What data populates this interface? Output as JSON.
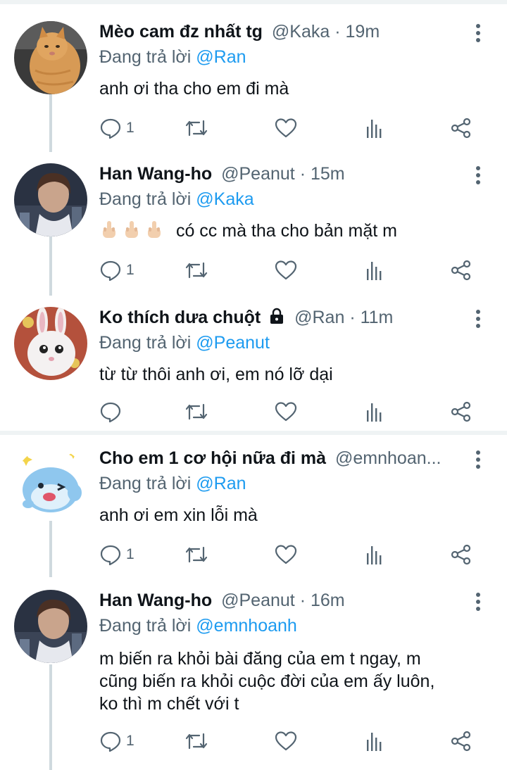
{
  "tweets": [
    {
      "name": "Mèo cam đz nhất tg",
      "handle": "@Kaka",
      "time": "19m",
      "reply_prefix": "Đang trả lời",
      "reply_to": "@Ran",
      "text": "anh ơi tha cho em đi mà",
      "reply_count": "1",
      "avatar": "cat-avatar"
    },
    {
      "name": "Han Wang-ho",
      "handle": "@Peanut",
      "time": "15m",
      "reply_prefix": "Đang trả lời",
      "reply_to": "@Kaka",
      "text": "có cc mà tha cho bản mặt m",
      "emoji": "middle-finger-emoji x3",
      "reply_count": "1",
      "avatar": "person-avatar"
    },
    {
      "name": "Ko thích dưa chuột",
      "handle": "@Ran",
      "time": "11m",
      "reply_prefix": "Đang trả lời",
      "reply_to": "@Peanut",
      "text": "từ từ thôi anh ơi, em nó lỡ dại",
      "reply_count": "",
      "avatar": "bunny-avatar",
      "protected": "lock-icon"
    },
    {
      "name": "Cho em 1 cơ hội nữa đi mà",
      "handle": "@emnhoan...",
      "time": "",
      "reply_prefix": "Đang trả lời",
      "reply_to": "@Ran",
      "text": "anh ơi em xin lỗi mà",
      "reply_count": "1",
      "avatar": "blue-creature-avatar"
    },
    {
      "name": "Han Wang-ho",
      "handle": "@Peanut",
      "time": "16m",
      "reply_prefix": "Đang trả lời",
      "reply_to": "@emnhoanh",
      "text_lines": [
        "m biến ra khỏi bài đăng của em t ngay, m",
        "cũng biến ra khỏi cuộc đời của em ấy luôn,",
        "ko thì m chết với t"
      ],
      "reply_count": "1",
      "avatar": "person-avatar"
    }
  ],
  "dot_separator": "·",
  "colors": {
    "text": "#0f1419",
    "secondary": "#536471",
    "link": "#1d9bf0",
    "border": "#eff3f4",
    "thread": "#cfd9de"
  }
}
